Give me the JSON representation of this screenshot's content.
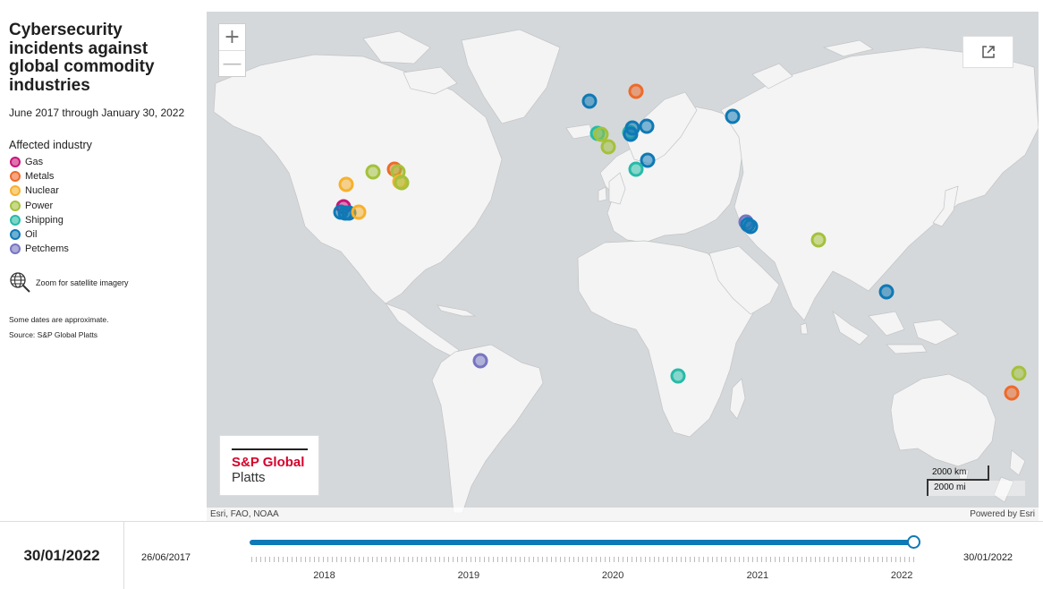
{
  "sidebar": {
    "title": "Cybersecurity incidents against global commodity industries",
    "subtitle": "June 2017 through January 30, 2022",
    "legend_title": "Affected industry",
    "legend": [
      {
        "label": "Gas",
        "color": "#c8157a"
      },
      {
        "label": "Metals",
        "color": "#ee6a2b"
      },
      {
        "label": "Nuclear",
        "color": "#f6b12d"
      },
      {
        "label": "Power",
        "color": "#a4c13b"
      },
      {
        "label": "Shipping",
        "color": "#26bba7"
      },
      {
        "label": "Oil",
        "color": "#0f79b5"
      },
      {
        "label": "Petchems",
        "color": "#7775c1"
      }
    ],
    "zoom_hint": "Zoom for satellite imagery",
    "note": "Some dates are approximate.",
    "source": "Source: S&P Global Platts"
  },
  "map": {
    "zoom_in": "+",
    "zoom_out": "—",
    "logo_line1": "S&P Global",
    "logo_line2": "Platts",
    "scale_km": "2000 km",
    "scale_mi": "2000 mi",
    "attribution_left": "Esri, FAO, NOAA",
    "attribution_right": "Powered by Esri",
    "incidents": [
      {
        "industry": "Nuclear",
        "lon": -97.5,
        "lat": 38.5
      },
      {
        "industry": "Gas",
        "lon": -98.5,
        "lat": 31.5
      },
      {
        "industry": "Oil",
        "lon": -99.5,
        "lat": 29.8
      },
      {
        "industry": "Oil",
        "lon": -98.0,
        "lat": 29.6
      },
      {
        "industry": "Oil",
        "lon": -96.5,
        "lat": 29.6
      },
      {
        "industry": "Nuclear",
        "lon": -93.0,
        "lat": 29.9
      },
      {
        "industry": "Power",
        "lon": -87.5,
        "lat": 42.0
      },
      {
        "industry": "Metals",
        "lon": -79.5,
        "lat": 42.8
      },
      {
        "industry": "Power",
        "lon": -78.2,
        "lat": 42.0
      },
      {
        "industry": "Nuclear",
        "lon": -77.5,
        "lat": 39.2
      },
      {
        "industry": "Power",
        "lon": -77.0,
        "lat": 39.0
      },
      {
        "industry": "Oil",
        "lon": -7.0,
        "lat": 58.5
      },
      {
        "industry": "Metals",
        "lon": 10.5,
        "lat": 60.5
      },
      {
        "industry": "Shipping",
        "lon": -4.0,
        "lat": 51.8
      },
      {
        "industry": "Power",
        "lon": -2.5,
        "lat": 51.5
      },
      {
        "industry": "Power",
        "lon": 0.0,
        "lat": 48.5
      },
      {
        "industry": "Shipping",
        "lon": 8.0,
        "lat": 52.0
      },
      {
        "industry": "Oil",
        "lon": 9.0,
        "lat": 53.0
      },
      {
        "industry": "Oil",
        "lon": 8.5,
        "lat": 51.5
      },
      {
        "industry": "Oil",
        "lon": 14.5,
        "lat": 53.3
      },
      {
        "industry": "Oil",
        "lon": 14.8,
        "lat": 45.0
      },
      {
        "industry": "Shipping",
        "lon": 10.5,
        "lat": 42.8
      },
      {
        "industry": "Oil",
        "lon": 46.5,
        "lat": 55.5
      },
      {
        "industry": "Petchems",
        "lon": 51.5,
        "lat": 26.5
      },
      {
        "industry": "Oil",
        "lon": 52.0,
        "lat": 25.7
      },
      {
        "industry": "Oil",
        "lon": 53.0,
        "lat": 25.3
      },
      {
        "industry": "Power",
        "lon": 78.5,
        "lat": 20.5
      },
      {
        "industry": "Oil",
        "lon": 103.8,
        "lat": 1.5
      },
      {
        "industry": "Shipping",
        "lon": 26.0,
        "lat": -28.5
      },
      {
        "industry": "Petchems",
        "lon": -47.5,
        "lat": -23.2
      },
      {
        "industry": "Power",
        "lon": 153.0,
        "lat": -27.5
      },
      {
        "industry": "Metals",
        "lon": 150.5,
        "lat": -33.8
      }
    ]
  },
  "timeline": {
    "current_date": "30/01/2022",
    "start_date": "26/06/2017",
    "end_date": "30/01/2022",
    "years": [
      "2018",
      "2019",
      "2020",
      "2021",
      "2022"
    ],
    "progress": 1.0
  }
}
